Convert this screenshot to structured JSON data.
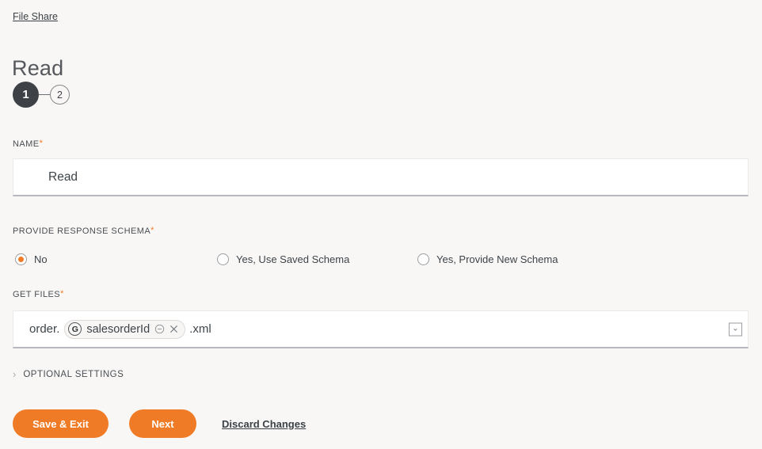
{
  "breadcrumb": {
    "label": "File Share"
  },
  "header": {
    "title": "Read"
  },
  "stepper": {
    "steps": [
      {
        "number": "1",
        "state": "active"
      },
      {
        "number": "2",
        "state": "inactive"
      }
    ]
  },
  "form": {
    "name_field": {
      "label": "NAME",
      "required_marker": "*",
      "value": "Read"
    },
    "schema_field": {
      "label": "PROVIDE RESPONSE SCHEMA",
      "required_marker": "*",
      "options": [
        {
          "label": "No",
          "selected": true
        },
        {
          "label": "Yes, Use Saved Schema",
          "selected": false
        },
        {
          "label": "Yes, Provide New Schema",
          "selected": false
        }
      ]
    },
    "get_files_field": {
      "label": "GET FILES",
      "required_marker": "*",
      "prefix_text": "order.",
      "token": {
        "badge": "G",
        "label": "salesorderId",
        "minus_icon": "minus-circle-icon",
        "close_icon": "close-icon"
      },
      "suffix_text": ".xml",
      "caret": "⌄"
    },
    "optional_settings": {
      "label": "OPTIONAL SETTINGS",
      "chevron": "›",
      "expanded": false
    }
  },
  "footer": {
    "save_label": "Save & Exit",
    "next_label": "Next",
    "discard_label": "Discard Changes"
  },
  "colors": {
    "accent": "#f07b27",
    "page_background": "#f8f7f5",
    "step_active": "#3e4247",
    "text": "#3e4449"
  }
}
